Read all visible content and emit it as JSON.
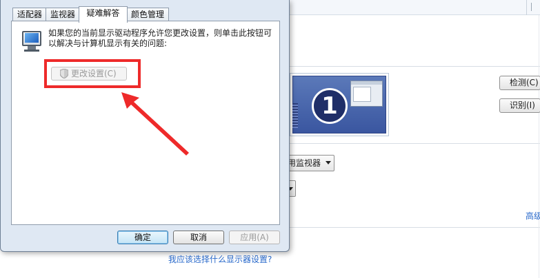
{
  "dialog": {
    "tabs": [
      "适配器",
      "监视器",
      "疑难解答",
      "颜色管理"
    ],
    "active_tab": "疑难解答",
    "description": "如果您的当前显示驱动程序允许您更改设置，则单击此按钮可以解决与计算机显示有关的问题:",
    "change_settings_label": "更改设置(C)",
    "ok_label": "确定",
    "cancel_label": "取消",
    "apply_label": "应用(A)"
  },
  "background": {
    "monitor_number": "1",
    "detect_label": "检测(C)",
    "identify_label": "识别(I)",
    "multi_display_value": "用监视器",
    "advanced_link": "高级",
    "help_link": "我应该选择什么显示器设置?"
  },
  "colors": {
    "highlight": "#ee2a2a",
    "link": "#2a6acb",
    "dialog_bg": "#dfe8f3"
  },
  "icons": [
    "monitor-icon",
    "shield-icon",
    "dropdown-arrow-icon"
  ]
}
